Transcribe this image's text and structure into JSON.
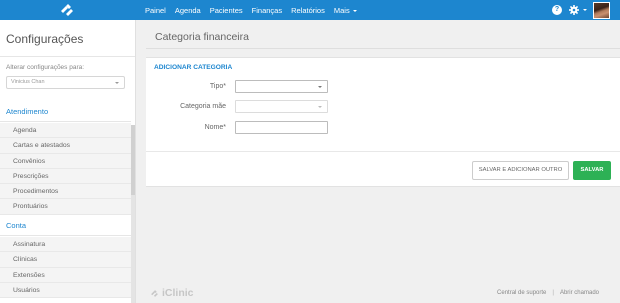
{
  "nav": {
    "items": [
      "Painel",
      "Agenda",
      "Pacientes",
      "Finanças",
      "Relatórios",
      "Mais"
    ]
  },
  "topbar": {
    "help_glyph": "?"
  },
  "sidebar": {
    "title": "Configurações",
    "alter_label": "Alterar configurações para:",
    "selected_user": "Vinicius Chan",
    "sections": [
      {
        "label": "Atendimento",
        "items": [
          "Agenda",
          "Cartas e atestados",
          "Convênios",
          "Prescrições",
          "Procedimentos",
          "Prontuários"
        ]
      },
      {
        "label": "Conta",
        "items": [
          "Assinatura",
          "Clínicas",
          "Extensões",
          "Usuários"
        ]
      }
    ]
  },
  "main": {
    "title": "Categoria financeira",
    "form": {
      "heading": "ADICIONAR CATEGORIA",
      "fields": [
        {
          "label": "Tipo*",
          "type": "select",
          "value": ""
        },
        {
          "label": "Categoria mãe",
          "type": "select",
          "value": ""
        },
        {
          "label": "Nome*",
          "type": "text",
          "value": ""
        }
      ],
      "buttons": {
        "save_add": "SALVAR E ADICIONAR OUTRO",
        "save": "SALVAR"
      }
    }
  },
  "footer": {
    "brand": "iClinic",
    "links": [
      "Central de suporte",
      "Abrir chamado"
    ],
    "separator": "|"
  },
  "colors": {
    "brand_blue": "#1d86cf",
    "save_green": "#2db155"
  }
}
